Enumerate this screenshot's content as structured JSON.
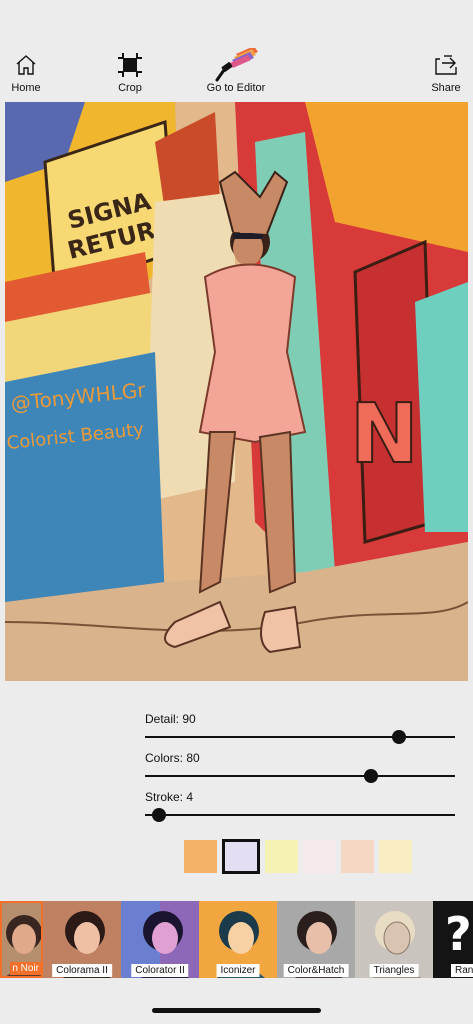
{
  "toolbar": {
    "home_label": "Home",
    "crop_label": "Crop",
    "editor_label": "Go to Editor",
    "share_label": "Share"
  },
  "artwork": {
    "wall_text": [
      "SIGNA",
      "RETUR"
    ],
    "graffiti_text": [
      "@TonyWHLGr",
      "Colorist Beauty"
    ],
    "mural_letters": "NE"
  },
  "sliders": [
    {
      "label": "Detail: 90",
      "value": 90
    },
    {
      "label": "Colors: 80",
      "value": 80
    },
    {
      "label": "Stroke: 4",
      "value": 4
    }
  ],
  "swatches": [
    {
      "color": "#f4b268",
      "selected": false
    },
    {
      "color": "#e4def2",
      "selected": true
    },
    {
      "color": "#f6f2b4",
      "selected": false
    },
    {
      "color": "#f6eaec",
      "selected": false
    },
    {
      "color": "#f4d8c4",
      "selected": false
    },
    {
      "color": "#f8eec2",
      "selected": false
    }
  ],
  "filters": [
    {
      "label": "n Noir",
      "bg": "#b58f6d",
      "selected": true
    },
    {
      "label": "Colorama II",
      "bg": "#c08062",
      "selected": false
    },
    {
      "label": "Colorator II",
      "bg": "#8d67b8",
      "selected": false
    },
    {
      "label": "Iconizer",
      "bg": "#f1a640",
      "selected": false
    },
    {
      "label": "Color&Hatch",
      "bg": "#a8a8a8",
      "selected": false
    },
    {
      "label": "Triangles",
      "bg": "#c9c5be",
      "selected": false
    },
    {
      "label": "Ran",
      "bg": "#141414",
      "selected": false
    }
  ],
  "colors": {
    "accent": "#f2702a",
    "background": "#ececec",
    "foreground": "#111111"
  }
}
